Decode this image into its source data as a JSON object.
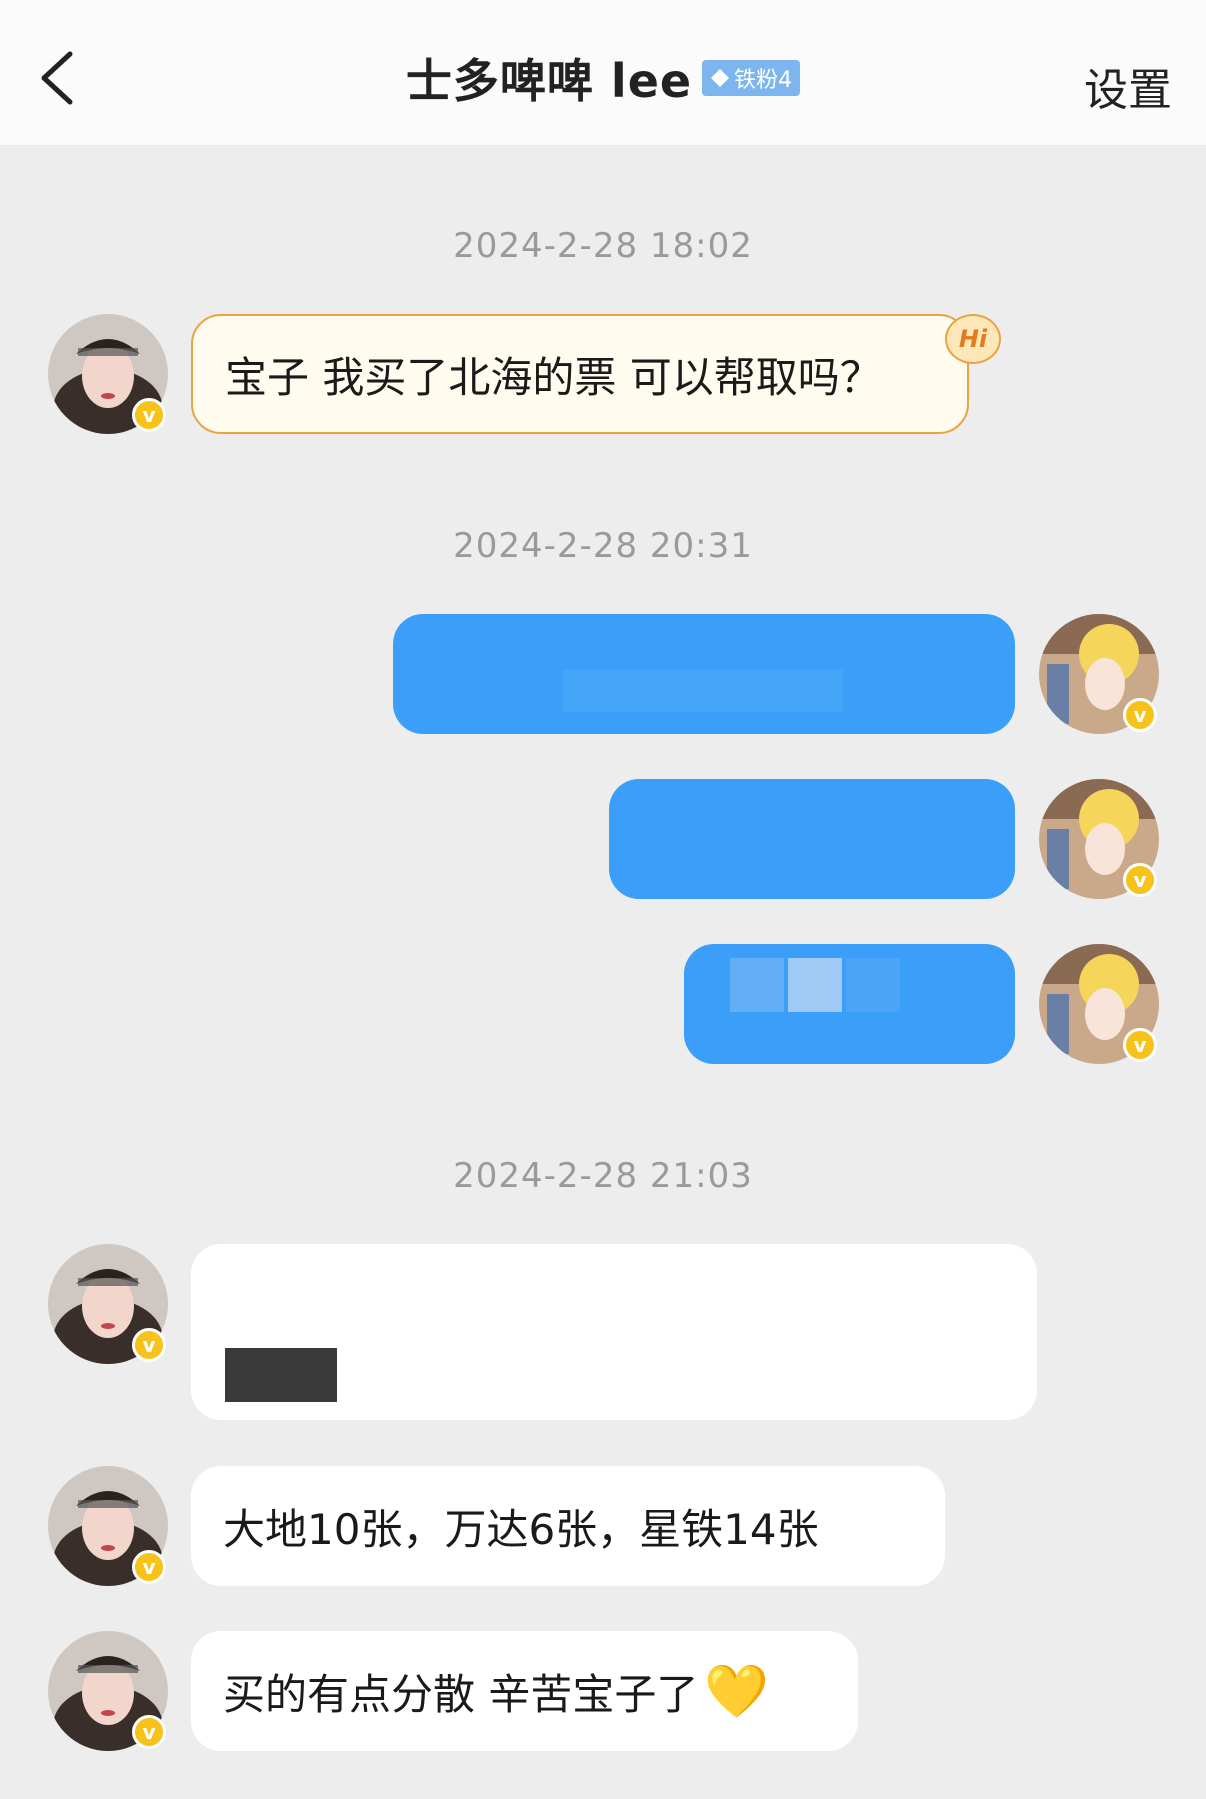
{
  "header": {
    "back_label": "<",
    "title": "士多啤啤 lee",
    "fan_badge": "铁粉4",
    "settings_label": "设置"
  },
  "timestamps": [
    "2024-2-28 18:02",
    "2024-2-28 20:31",
    "2024-2-28 21:03"
  ],
  "messages": {
    "m1": "宝子 我买了北海的票 可以帮取吗？",
    "m1_badge": "Hi",
    "m5": "大地10张，万达6张，星铁14张",
    "m6": "买的有点分散 辛苦宝子了",
    "m6_emoji": "💛"
  },
  "verified_mark": "v",
  "colors": {
    "background": "#ededed",
    "sent_bubble": "#3b9ef8",
    "received_bubble": "#ffffff",
    "verified_badge": "#f7c21a"
  },
  "icons": [
    "back-chevron-icon",
    "diamond-icon",
    "heart-icon"
  ]
}
